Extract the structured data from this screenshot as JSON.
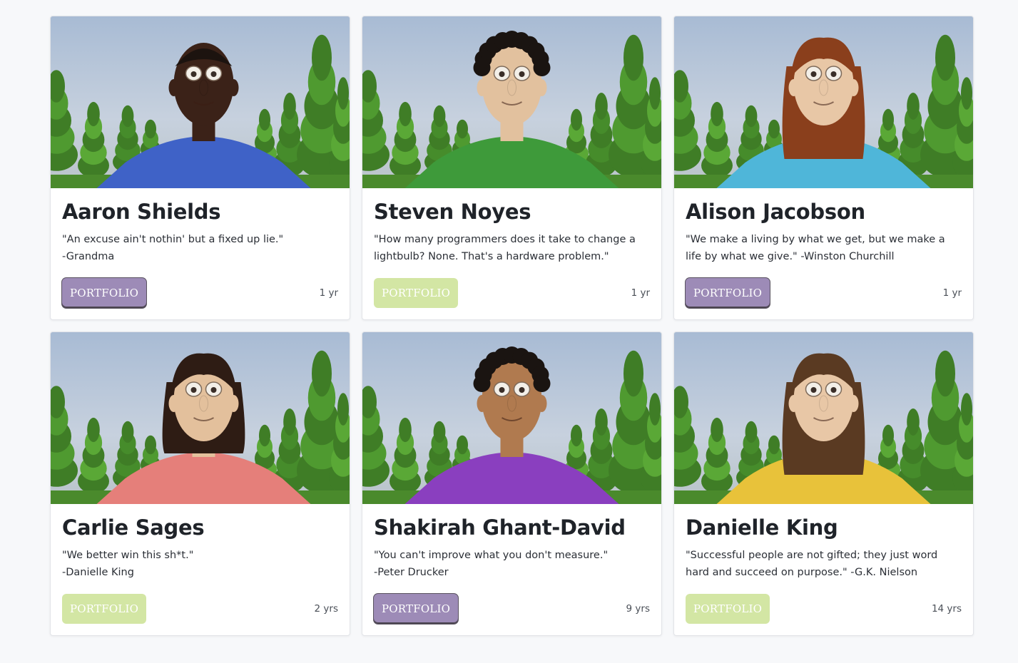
{
  "people": [
    {
      "name": "Aaron Shields",
      "quote": "\"An excuse ain't nothin' but a fixed up lie.\"",
      "author": "-Grandma",
      "button_label": "PORTFOLIO",
      "button_style": "purple",
      "experience": "1 yr",
      "skin_color": "#3b2218",
      "hair_color": "#1c130f",
      "shirt_color": "#3f62c7",
      "hair_style": "short"
    },
    {
      "name": "Steven Noyes",
      "quote": "\"How many programmers does it take to change a lightbulb? None. That's a hardware problem.\"",
      "author": "",
      "button_label": "PORTFOLIO",
      "button_style": "green",
      "experience": "1 yr",
      "skin_color": "#e2c19e",
      "hair_color": "#1a1411",
      "shirt_color": "#3e9a3a",
      "hair_style": "curly"
    },
    {
      "name": "Alison Jacobson",
      "quote": "\"We make a living by what we get, but we make a life by what we give.\" -Winston Churchill",
      "author": "",
      "button_label": "PORTFOLIO",
      "button_style": "purple",
      "experience": "1 yr",
      "skin_color": "#e8c7a6",
      "hair_color": "#8a3f1c",
      "shirt_color": "#4fb6d9",
      "hair_style": "long"
    },
    {
      "name": "Carlie Sages",
      "quote": "\"We better win this sh*t.\"",
      "author": "-Danielle King",
      "button_label": "PORTFOLIO",
      "button_style": "green",
      "experience": "2 yrs",
      "skin_color": "#e3c09c",
      "hair_color": "#2e1c14",
      "shirt_color": "#e57f7a",
      "hair_style": "bob"
    },
    {
      "name": "Shakirah Ghant-David",
      "quote": "\"You can't improve what you don't measure.\"",
      "author": "-Peter Drucker",
      "button_label": "PORTFOLIO",
      "button_style": "purple",
      "experience": "9 yrs",
      "skin_color": "#b07a4f",
      "hair_color": "#1a1411",
      "shirt_color": "#8a3fbf",
      "hair_style": "curly"
    },
    {
      "name": "Danielle King",
      "quote": "\"Successful people are not gifted; they just word hard and succeed on purpose.\" -G.K. Nielson",
      "author": "",
      "button_label": "PORTFOLIO",
      "button_style": "green",
      "experience": "14 yrs",
      "skin_color": "#e8c7a6",
      "hair_color": "#5a3a22",
      "shirt_color": "#e8c23a",
      "hair_style": "long"
    }
  ]
}
